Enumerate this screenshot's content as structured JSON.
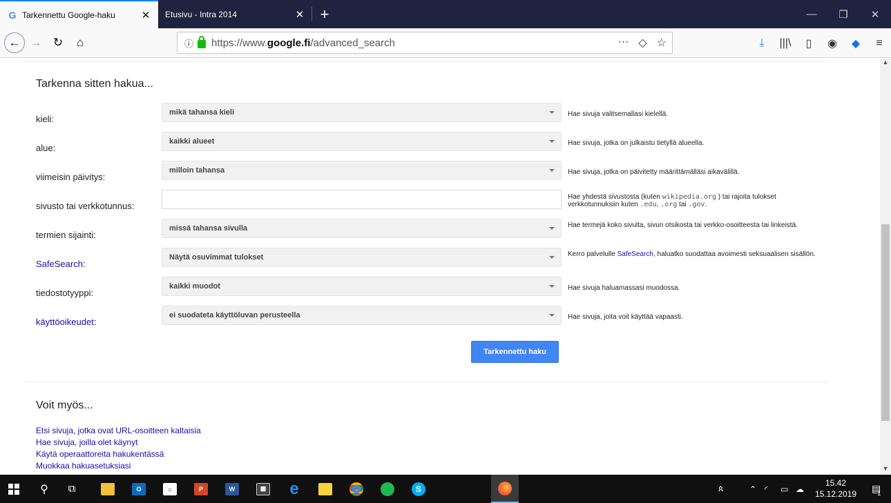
{
  "tabs": [
    {
      "title": "Tarkennettu Google-haku",
      "favicon": "G",
      "close": "✕",
      "active": true
    },
    {
      "title": "Etusivu - Intra 2014",
      "close": "✕",
      "active": false
    }
  ],
  "new_tab": "+",
  "window_controls": {
    "minimize": "—",
    "restore": "❐",
    "close": "✕"
  },
  "url": {
    "prefix": "https://www.",
    "domain": "google.fi",
    "path": "/advanced_search"
  },
  "url_actions": {
    "more": "···",
    "pocket": "◇",
    "bookmark": "☆"
  },
  "section1_title": "Tarkenna sitten hakua...",
  "rows": [
    {
      "label": "kieli:",
      "value": "mikä tahansa kieli",
      "hint": "Hae sivuja valitsemallasi kielellä."
    },
    {
      "label": "alue:",
      "value": "kaikki alueet",
      "hint": "Hae sivuja, jotka on julkaistu tietyllä alueella."
    },
    {
      "label": "viimeisin päivitys:",
      "value": "milloin tahansa",
      "hint": "Hae sivuja, jotka on päivitetty määrittämälläsi aikavälillä."
    },
    {
      "label": "sivusto tai verkkotunnus:",
      "value": "",
      "hint_a": "Hae yhdestä sivustosta (kuten ",
      "hint_mono1": "wikipedia.org",
      "hint_b": " ) tai rajoita tulokset verkkotunnuksiin kuten ",
      "hint_mono2": ".edu",
      "hint_c": ", ",
      "hint_mono3": ".org",
      "hint_d": " tai ",
      "hint_mono4": ".gov",
      "hint_e": "."
    },
    {
      "label": "termien sijainti:",
      "value": "missä tahansa sivulla",
      "hint": "Hae termejä koko sivulta, sivun otsikosta tai verkko-osoitteesta tai linkeistä."
    },
    {
      "label": "SafeSearch:",
      "value": "Näytä osuvimmat tulokset",
      "hint_a": "Kerro palvelulle ",
      "hint_link": "SafeSearch",
      "hint_b": ", haluatko suodattaa avoimesti seksuaalisen sisällön."
    },
    {
      "label": "tiedostotyyppi:",
      "value": "kaikki muodot",
      "hint": "Hae sivuja haluamassasi muodossa."
    },
    {
      "label": "käyttöoikeudet:",
      "value": "ei suodateta käyttöluvan perusteella",
      "hint": "Hae sivuja, joita voit käyttää vapaasti."
    }
  ],
  "submit_label": "Tarkennettu haku",
  "section2_title": "Voit myös...",
  "also_links": [
    "Etsi sivuja, jotka ovat URL-osoitteen kaltaisia",
    "Hae sivuja, joilla olet käynyt",
    "Käytä operaattoreita hakukentässä",
    "Muokkaa hakuasetuksiasi"
  ],
  "clock": {
    "time": "15.42",
    "date": "15.12.2019"
  },
  "notification_count": "1",
  "colors": {
    "accent": "#4285f4",
    "link": "#1a0dab",
    "tabbar": "#202340",
    "taskbar": "#101010"
  }
}
